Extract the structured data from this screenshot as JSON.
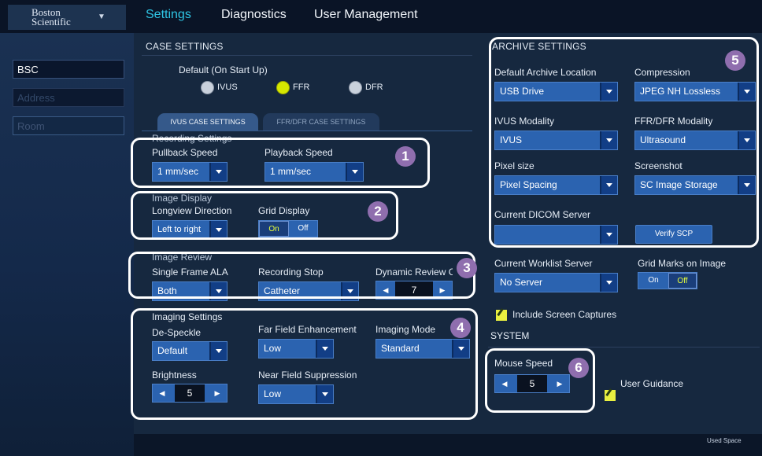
{
  "header": {
    "brand_line1": "Boston",
    "brand_line2": "Scientific",
    "brand_caret": "▼",
    "nav": [
      "Settings",
      "Diagnostics",
      "User Management"
    ]
  },
  "sidebar": {
    "fields": [
      "BSC",
      "Address",
      "Room"
    ]
  },
  "case_settings": {
    "title": "CASE SETTINGS",
    "default_label": "Default (On Start Up)",
    "radios": [
      {
        "label": "IVUS",
        "selected": false
      },
      {
        "label": "FFR",
        "selected": true
      },
      {
        "label": "DFR",
        "selected": false
      }
    ],
    "tabs": [
      "IVUS CASE SETTINGS",
      "FFR/DFR CASE SETTINGS"
    ],
    "recording": {
      "title": "Recording Settings",
      "pullback_label": "Pullback Speed",
      "pullback_value": "1 mm/sec",
      "playback_label": "Playback Speed",
      "playback_value": "1 mm/sec"
    },
    "image_display": {
      "title": "Image Display",
      "longview_label": "Longview Direction",
      "longview_value": "Left to right",
      "grid_label": "Grid Display",
      "grid_on": "On",
      "grid_off": "Off"
    },
    "image_review": {
      "title": "Image Review",
      "single_frame_label": "Single Frame ALA",
      "single_frame_value": "Both",
      "recording_stop_label": "Recording Stop",
      "recording_stop_value": "Catheter",
      "dynamic_label": "Dynamic Review Cine Size",
      "dynamic_value": "7"
    },
    "imaging": {
      "title": "Imaging Settings",
      "despeckle_label": "De-Speckle",
      "despeckle_value": "Default",
      "far_field_label": "Far Field Enhancement",
      "far_field_value": "Low",
      "mode_label": "Imaging Mode",
      "mode_value": "Standard",
      "brightness_label": "Brightness",
      "brightness_value": "5",
      "near_field_label": "Near Field Suppression",
      "near_field_value": "Low"
    }
  },
  "archive": {
    "title": "ARCHIVE SETTINGS",
    "location_label": "Default Archive Location",
    "location_value": "USB Drive",
    "compression_label": "Compression",
    "compression_value": "JPEG NH Lossless",
    "ivus_modality_label": "IVUS Modality",
    "ivus_modality_value": "IVUS",
    "ffr_modality_label": "FFR/DFR Modality",
    "ffr_modality_value": "Ultrasound",
    "pixel_label": "Pixel size",
    "pixel_value": "Pixel Spacing",
    "screenshot_label": "Screenshot",
    "screenshot_value": "SC Image Storage",
    "dicom_label": "Current DICOM Server",
    "dicom_value": "",
    "verify_button": "Verify SCP",
    "worklist_label": "Current Worklist Server",
    "worklist_value": "No Server",
    "gridmarks_label": "Grid Marks on Image",
    "gridmarks_on": "On",
    "gridmarks_off": "Off",
    "include_captures": "Include Screen Captures"
  },
  "system": {
    "title": "SYSTEM",
    "mouse_label": "Mouse Speed",
    "mouse_value": "5",
    "guidance": "User Guidance"
  },
  "footer": {
    "used_space": "Used Space"
  },
  "callouts": [
    "1",
    "2",
    "3",
    "4",
    "5",
    "6"
  ],
  "icons": {
    "left_arrow": "◀",
    "right_arrow": "▶"
  },
  "colors": {
    "accent": "#2fc7e6",
    "selected": "#d6e800",
    "control": "#2b63b0",
    "badge": "#8f6eae"
  }
}
